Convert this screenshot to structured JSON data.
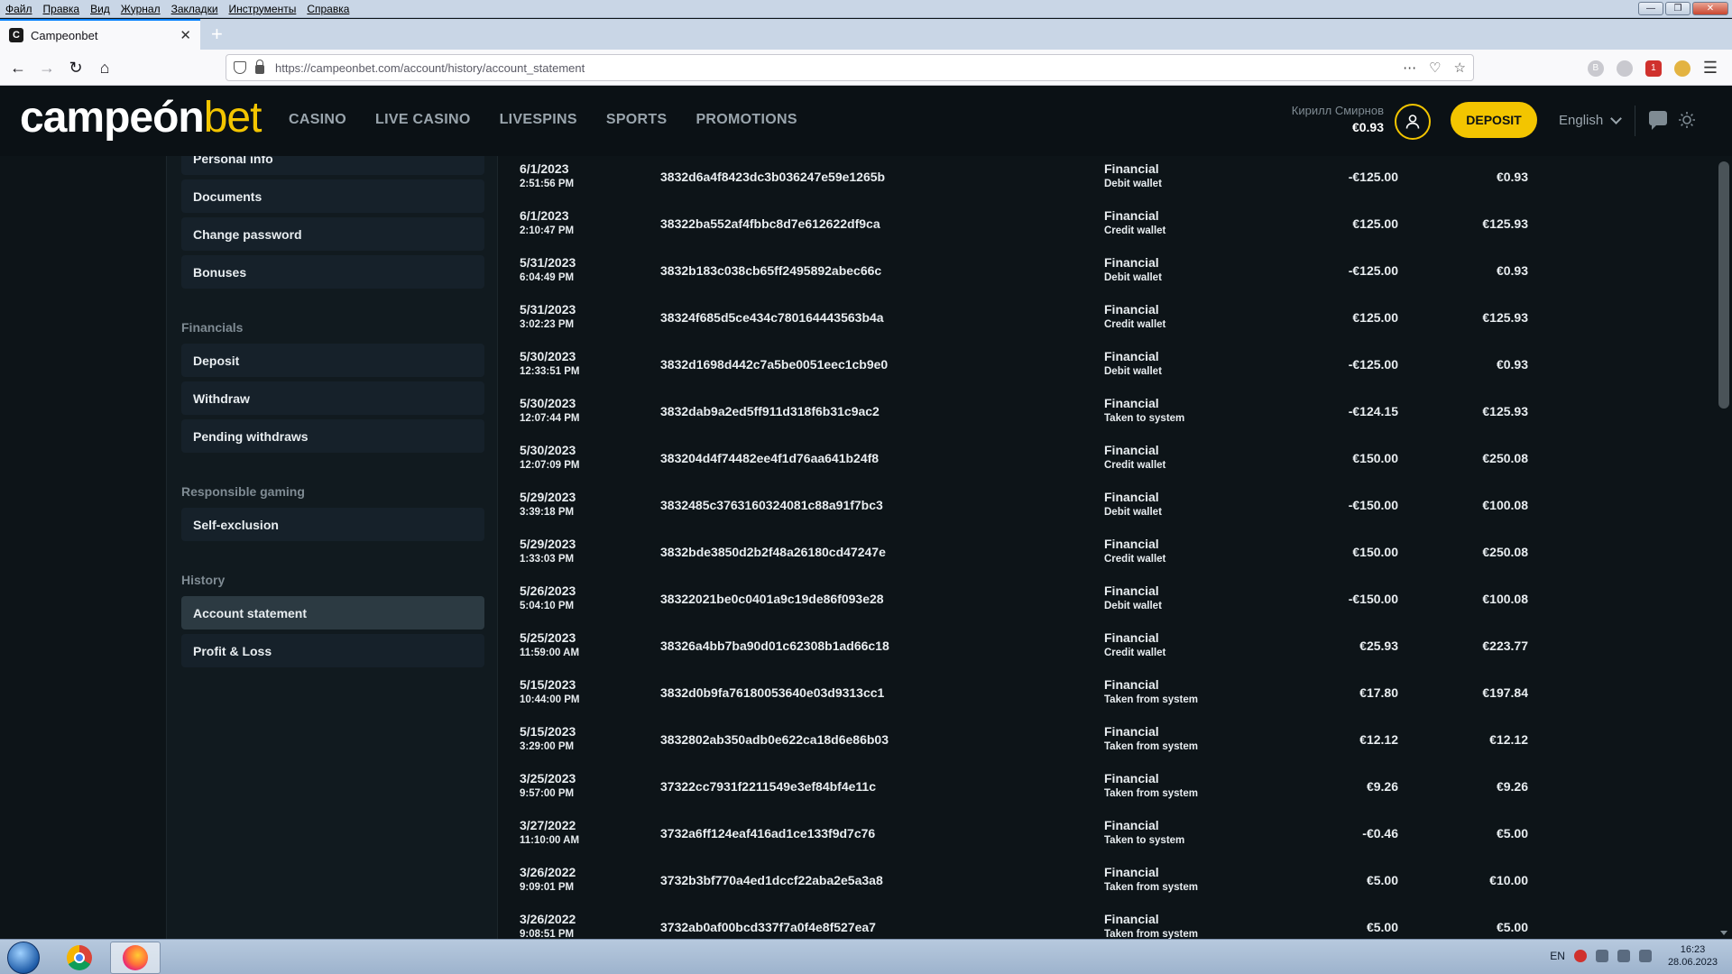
{
  "os_menu": [
    "Файл",
    "Правка",
    "Вид",
    "Журнал",
    "Закладки",
    "Инструменты",
    "Справка"
  ],
  "browser": {
    "tab_title": "Campeonbet",
    "favicon_letter": "C",
    "url": "https://campeonbet.com/account/history/account_statement",
    "ext_badge": "1"
  },
  "site": {
    "logo_main": "campeón",
    "logo_accent": "bet",
    "nav": [
      "CASINO",
      "LIVE CASINO",
      "LIVESPINS",
      "SPORTS",
      "PROMOTIONS"
    ],
    "user_name": "Кирилл Смирнов",
    "user_balance": "€0.93",
    "deposit_label": "DEPOSIT",
    "language": "English"
  },
  "sidebar": {
    "account_items": [
      "Personal info",
      "Documents",
      "Change password",
      "Bonuses"
    ],
    "financials_title": "Financials",
    "financials_items": [
      "Deposit",
      "Withdraw",
      "Pending withdraws"
    ],
    "responsible_title": "Responsible gaming",
    "responsible_items": [
      "Self-exclusion"
    ],
    "history_title": "History",
    "history_items": [
      "Account statement",
      "Profit & Loss"
    ],
    "active_item": "Account statement"
  },
  "transactions": [
    {
      "date": "6/1/2023",
      "time": "2:51:56 PM",
      "id": "3832d6a4f8423dc3b036247e59e1265b",
      "type": "Financial",
      "sub": "Debit wallet",
      "amount": "-€125.00",
      "balance": "€0.93"
    },
    {
      "date": "6/1/2023",
      "time": "2:10:47 PM",
      "id": "38322ba552af4fbbc8d7e612622df9ca",
      "type": "Financial",
      "sub": "Credit wallet",
      "amount": "€125.00",
      "balance": "€125.93"
    },
    {
      "date": "5/31/2023",
      "time": "6:04:49 PM",
      "id": "3832b183c038cb65ff2495892abec66c",
      "type": "Financial",
      "sub": "Debit wallet",
      "amount": "-€125.00",
      "balance": "€0.93"
    },
    {
      "date": "5/31/2023",
      "time": "3:02:23 PM",
      "id": "38324f685d5ce434c780164443563b4a",
      "type": "Financial",
      "sub": "Credit wallet",
      "amount": "€125.00",
      "balance": "€125.93"
    },
    {
      "date": "5/30/2023",
      "time": "12:33:51 PM",
      "id": "3832d1698d442c7a5be0051eec1cb9e0",
      "type": "Financial",
      "sub": "Debit wallet",
      "amount": "-€125.00",
      "balance": "€0.93"
    },
    {
      "date": "5/30/2023",
      "time": "12:07:44 PM",
      "id": "3832dab9a2ed5ff911d318f6b31c9ac2",
      "type": "Financial",
      "sub": "Taken to system",
      "amount": "-€124.15",
      "balance": "€125.93"
    },
    {
      "date": "5/30/2023",
      "time": "12:07:09 PM",
      "id": "383204d4f74482ee4f1d76aa641b24f8",
      "type": "Financial",
      "sub": "Credit wallet",
      "amount": "€150.00",
      "balance": "€250.08"
    },
    {
      "date": "5/29/2023",
      "time": "3:39:18 PM",
      "id": "3832485c3763160324081c88a91f7bc3",
      "type": "Financial",
      "sub": "Debit wallet",
      "amount": "-€150.00",
      "balance": "€100.08"
    },
    {
      "date": "5/29/2023",
      "time": "1:33:03 PM",
      "id": "3832bde3850d2b2f48a26180cd47247e",
      "type": "Financial",
      "sub": "Credit wallet",
      "amount": "€150.00",
      "balance": "€250.08"
    },
    {
      "date": "5/26/2023",
      "time": "5:04:10 PM",
      "id": "38322021be0c0401a9c19de86f093e28",
      "type": "Financial",
      "sub": "Debit wallet",
      "amount": "-€150.00",
      "balance": "€100.08"
    },
    {
      "date": "5/25/2023",
      "time": "11:59:00 AM",
      "id": "38326a4bb7ba90d01c62308b1ad66c18",
      "type": "Financial",
      "sub": "Credit wallet",
      "amount": "€25.93",
      "balance": "€223.77"
    },
    {
      "date": "5/15/2023",
      "time": "10:44:00 PM",
      "id": "3832d0b9fa76180053640e03d9313cc1",
      "type": "Financial",
      "sub": "Taken from system",
      "amount": "€17.80",
      "balance": "€197.84"
    },
    {
      "date": "5/15/2023",
      "time": "3:29:00 PM",
      "id": "3832802ab350adb0e622ca18d6e86b03",
      "type": "Financial",
      "sub": "Taken from system",
      "amount": "€12.12",
      "balance": "€12.12"
    },
    {
      "date": "3/25/2023",
      "time": "9:57:00 PM",
      "id": "37322cc7931f2211549e3ef84bf4e11c",
      "type": "Financial",
      "sub": "Taken from system",
      "amount": "€9.26",
      "balance": "€9.26"
    },
    {
      "date": "3/27/2022",
      "time": "11:10:00 AM",
      "id": "3732a6ff124eaf416ad1ce133f9d7c76",
      "type": "Financial",
      "sub": "Taken to system",
      "amount": "-€0.46",
      "balance": "€5.00"
    },
    {
      "date": "3/26/2022",
      "time": "9:09:01 PM",
      "id": "3732b3bf770a4ed1dccf22aba2e5a3a8",
      "type": "Financial",
      "sub": "Taken from system",
      "amount": "€5.00",
      "balance": "€10.00"
    },
    {
      "date": "3/26/2022",
      "time": "9:08:51 PM",
      "id": "3732ab0af00bcd337f7a0f4e8f527ea7",
      "type": "Financial",
      "sub": "Taken from system",
      "amount": "€5.00",
      "balance": "€5.00"
    }
  ],
  "taskbar": {
    "lang": "EN",
    "time": "16:23",
    "date": "28.06.2023"
  },
  "colors": {
    "accent": "#f3c500",
    "background": "#0d1418",
    "sidebar_item": "#16212a",
    "sidebar_active": "#2c3a42"
  }
}
